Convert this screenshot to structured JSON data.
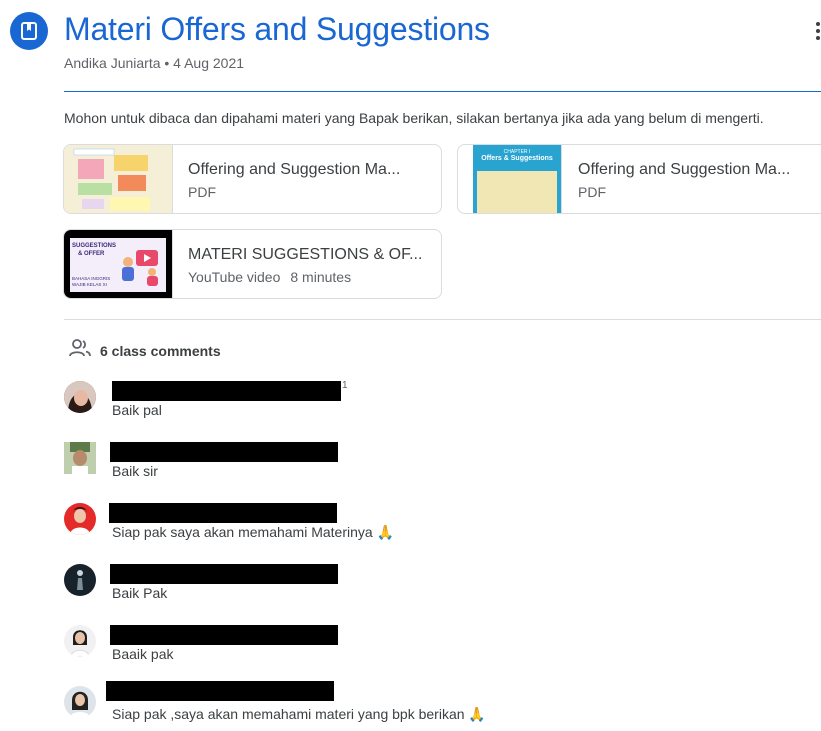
{
  "header": {
    "title": "Materi Offers and Suggestions",
    "meta": "Andika Juniarta • 4 Aug 2021"
  },
  "description": "Mohon untuk dibaca dan dipahami materi yang Bapak berikan, silakan bertanya jika ada yang belum di mengerti.",
  "attachments": [
    {
      "title": "Offering and Suggestion Ma...",
      "type": "PDF"
    },
    {
      "title": "Offering and Suggestion Ma...",
      "type": "PDF",
      "thumb_heading": "CHAPTER I",
      "thumb_title": "Offers & Suggestions"
    },
    {
      "title": "MATERI SUGGESTIONS & OF...",
      "type": "YouTube video",
      "duration": "8 minutes",
      "thumb_line1": "SUGGESTIONS",
      "thumb_line2": "& OFFER",
      "thumb_line3": "BAHASA INGGRIS",
      "thumb_line4": "WAJIB KELAS XI"
    }
  ],
  "comments_header": {
    "label": "6 class comments"
  },
  "comments": [
    {
      "text": "Baik pal"
    },
    {
      "text": "Baik sir"
    },
    {
      "text": "Siap pak saya akan memahami Materinya 🙏"
    },
    {
      "text": "Baik Pak"
    },
    {
      "text": "Baaik pak"
    },
    {
      "text": "Siap pak ,saya akan memahami materi yang bpk berikan 🙏"
    }
  ],
  "stray_mark": "1",
  "colors": {
    "accent": "#1967d2",
    "text": "#3c4043",
    "muted": "#5f6368",
    "divider": "#dadce0"
  }
}
